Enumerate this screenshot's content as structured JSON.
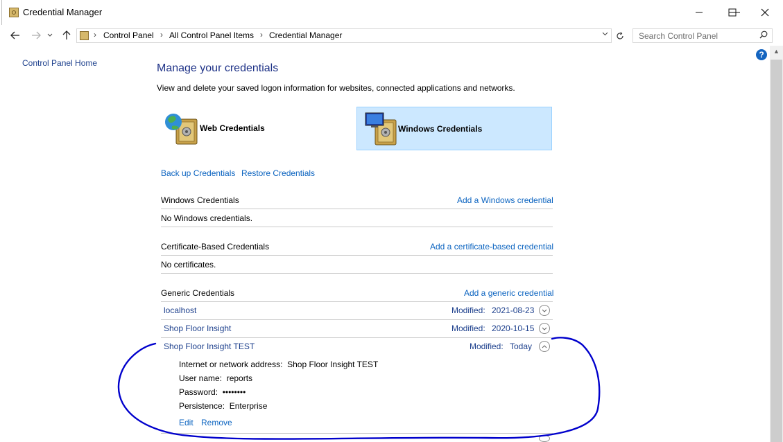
{
  "window": {
    "title": "Credential Manager"
  },
  "address": {
    "crumbs": [
      "Control Panel",
      "All Control Panel Items",
      "Credential Manager"
    ],
    "search_placeholder": "Search Control Panel"
  },
  "sidebar": {
    "home_label": "Control Panel Home"
  },
  "main": {
    "heading": "Manage your credentials",
    "subtitle": "View and delete your saved logon information for websites, connected applications and networks.",
    "tiles": {
      "web": "Web Credentials",
      "windows": "Windows Credentials"
    },
    "backup_label": "Back up Credentials",
    "restore_label": "Restore Credentials",
    "sections": {
      "windows": {
        "title": "Windows Credentials",
        "add_label": "Add a Windows credential",
        "empty": "No Windows credentials."
      },
      "certificate": {
        "title": "Certificate-Based Credentials",
        "add_label": "Add a certificate-based credential",
        "empty": "No certificates."
      },
      "generic": {
        "title": "Generic Credentials",
        "add_label": "Add a generic credential",
        "items": [
          {
            "name": "localhost",
            "modified_label": "Modified:",
            "modified": "2021-08-23"
          },
          {
            "name": "Shop Floor Insight",
            "modified_label": "Modified:",
            "modified": "2020-10-15"
          },
          {
            "name": "Shop Floor Insight TEST",
            "modified_label": "Modified:",
            "modified": "Today"
          }
        ]
      }
    },
    "details": {
      "address_label": "Internet or network address:",
      "address_value": "Shop Floor Insight TEST",
      "username_label": "User name:",
      "username_value": "reports",
      "password_label": "Password:",
      "password_value": "••••••••",
      "persistence_label": "Persistence:",
      "persistence_value": "Enterprise",
      "edit_label": "Edit",
      "remove_label": "Remove"
    }
  },
  "colors": {
    "link": "#0c64c0",
    "heading": "#1e3287",
    "selected_tile": "#cce8ff",
    "annotation": "#0000cc"
  },
  "icons": {
    "back": "arrow-left-icon",
    "forward": "arrow-right-icon",
    "up": "arrow-up-icon",
    "search": "magnifier-icon",
    "help": "question-icon"
  }
}
